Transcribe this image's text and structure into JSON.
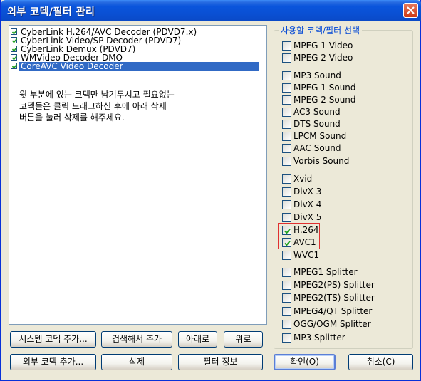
{
  "window": {
    "title": "외부 코덱/필터 관리"
  },
  "codec_list": {
    "items": [
      {
        "label": "CyberLink H.264/AVC Decoder (PDVD7.x)",
        "checked": true
      },
      {
        "label": "CyberLink Video/SP Decoder (PDVD7)",
        "checked": true
      },
      {
        "label": "CyberLink Demux (PDVD7)",
        "checked": true
      },
      {
        "label": "WMVideo Decoder DMO",
        "checked": true
      },
      {
        "label": "CoreAVC Video Decoder",
        "checked": true,
        "selected": true
      }
    ],
    "note": "윗 부분에 있는 코덱만 남겨두시고 필요없는\n코덱들은 클릭 드래그하신 후에 아래 삭제\n버튼을 눌러 삭제를 해주세요."
  },
  "group": {
    "title": "사용할 코덱/필터 선택",
    "options": [
      {
        "label": "MPEG 1 Video",
        "checked": false
      },
      {
        "label": "MPEG 2 Video",
        "checked": false
      },
      {
        "label": "MP3 Sound",
        "checked": false
      },
      {
        "label": "MPEG 1 Sound",
        "checked": false
      },
      {
        "label": "MPEG 2 Sound",
        "checked": false
      },
      {
        "label": "AC3 Sound",
        "checked": false
      },
      {
        "label": "DTS Sound",
        "checked": false
      },
      {
        "label": "LPCM Sound",
        "checked": false
      },
      {
        "label": "AAC Sound",
        "checked": false
      },
      {
        "label": "Vorbis Sound",
        "checked": false
      },
      {
        "label": "Xvid",
        "checked": false
      },
      {
        "label": "DivX 3",
        "checked": false
      },
      {
        "label": "DivX 4",
        "checked": false
      },
      {
        "label": "DivX 5",
        "checked": false
      },
      {
        "label": "H.264",
        "checked": true
      },
      {
        "label": "AVC1",
        "checked": true
      },
      {
        "label": "WVC1",
        "checked": false
      },
      {
        "label": "MPEG1 Splitter",
        "checked": false
      },
      {
        "label": "MPEG2(PS) Splitter",
        "checked": false
      },
      {
        "label": "MPEG2(TS) Splitter",
        "checked": false
      },
      {
        "label": "MPEG4/QT Splitter",
        "checked": false
      },
      {
        "label": "OGG/OGM Splitter",
        "checked": false
      },
      {
        "label": "MP3 Splitter",
        "checked": false
      }
    ]
  },
  "buttons": {
    "add_system": "시스템 코덱 추가...",
    "search_add": "검색해서 추가",
    "down": "아래로",
    "up": "위로",
    "add_external": "외부 코덱  추가...",
    "delete": "삭제",
    "filter_info": "필터 정보",
    "ok": "확인(O)",
    "cancel": "취소(C)"
  },
  "colors": {
    "accent": "#316ac5",
    "check": "#21a121",
    "highlight_box": "#e03030",
    "group_title": "#0046d5"
  }
}
